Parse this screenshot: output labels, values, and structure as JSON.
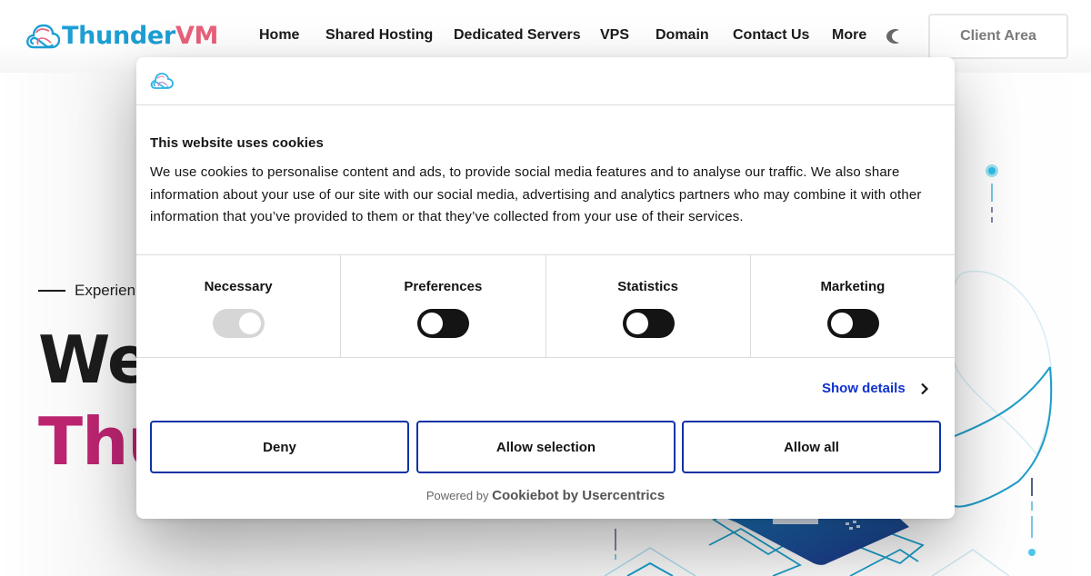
{
  "header": {
    "brand": {
      "part1": "Thunder",
      "part2": "VM"
    },
    "nav": [
      {
        "label": "Home"
      },
      {
        "label": "Shared Hosting"
      },
      {
        "label": "Dedicated Servers"
      },
      {
        "label": "VPS"
      },
      {
        "label": "Domain"
      },
      {
        "label": "Contact Us"
      },
      {
        "label": "More"
      }
    ],
    "theme_icon": "moon-icon",
    "client_area_label": "Client Area"
  },
  "hero": {
    "kicker": "Experien",
    "line1": "We",
    "line2": "Thu"
  },
  "cookie_dialog": {
    "title": "This website uses cookies",
    "body": "We use cookies to personalise content and ads, to provide social media features and to analyse our traffic. We also share information about your use of our site with our social media, advertising and analytics partners who may combine it with other information that you’ve provided to them or that they’ve collected from your use of their services.",
    "categories": [
      {
        "label": "Necessary",
        "enabled": true,
        "locked": true
      },
      {
        "label": "Preferences",
        "enabled": false,
        "locked": false
      },
      {
        "label": "Statistics",
        "enabled": false,
        "locked": false
      },
      {
        "label": "Marketing",
        "enabled": false,
        "locked": false
      }
    ],
    "show_details_label": "Show details",
    "buttons": {
      "deny": "Deny",
      "allow_selection": "Allow selection",
      "allow_all": "Allow all"
    },
    "powered_by_prefix": "Powered by",
    "powered_by_brand": "Cookiebot by Usercentrics"
  },
  "colors": {
    "brand_blue": "#1e9ed3",
    "brand_pink": "#e8617a",
    "hero_magenta": "#bc2470",
    "link_blue": "#1032cf",
    "button_border": "#1032a6"
  }
}
